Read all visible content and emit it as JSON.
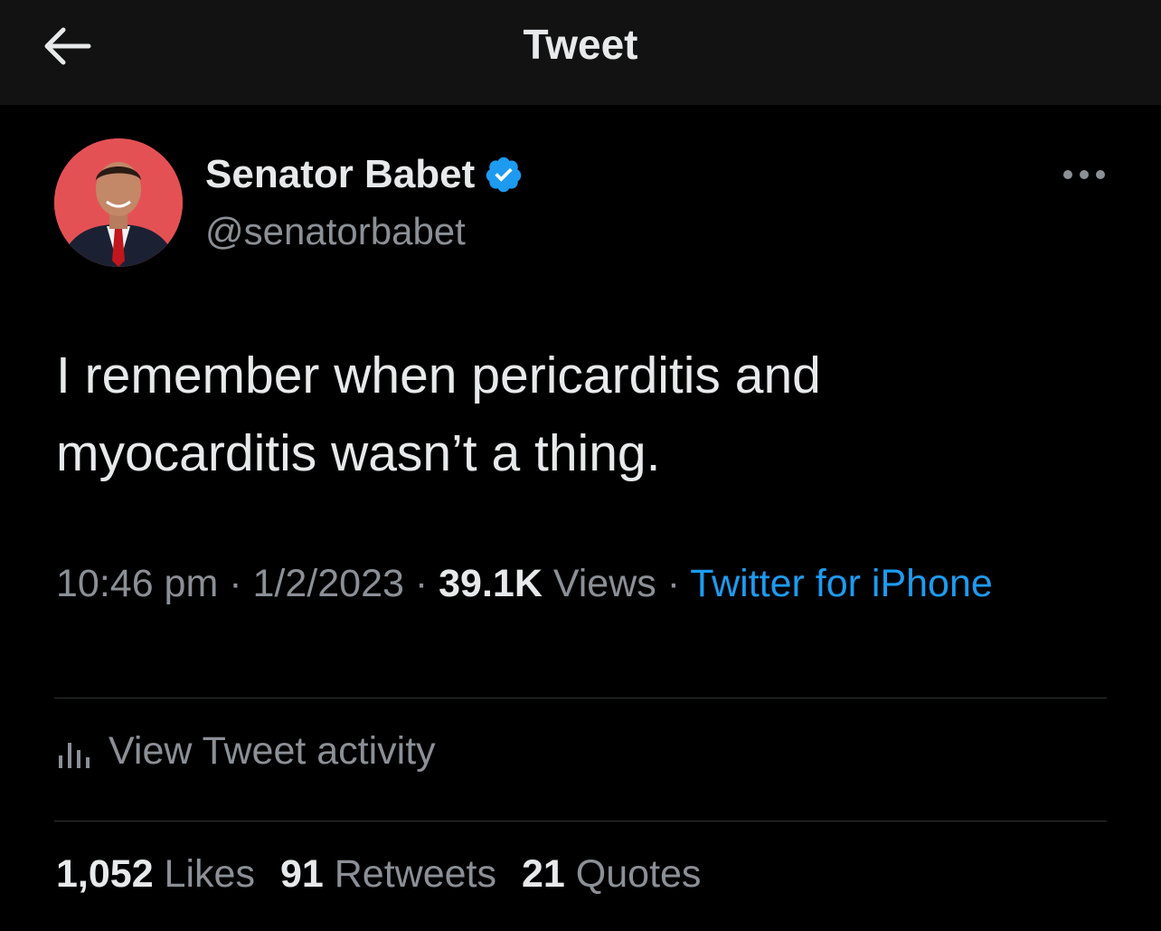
{
  "header": {
    "title": "Tweet",
    "back_icon": "arrow-left-icon"
  },
  "author": {
    "name": "Senator Babet",
    "handle": "@senatorbabet",
    "verified_icon": "verified-badge-icon",
    "verified_color": "#1d9bf0",
    "avatar_background": "#e0484d"
  },
  "more_icon": "more-options-icon",
  "tweet": {
    "text_line1": "I remember when pericarditis and",
    "text_line2": "myocarditis wasn’t a thing."
  },
  "meta": {
    "time": "10:46 pm",
    "sep1": " · ",
    "date": "1/2/2023",
    "sep2": " · ",
    "views_count": "39.1K",
    "views_label": " Views",
    "sep3": " · ",
    "source": "Twitter for iPhone",
    "source_color": "#1d9bf0"
  },
  "activity": {
    "icon": "analytics-icon",
    "label": "View Tweet activity"
  },
  "stats": {
    "likes_count": "1,052",
    "likes_label": " Likes",
    "retweets_count": "91",
    "retweets_label": " Retweets",
    "quotes_count": "21",
    "quotes_label": " Quotes"
  }
}
